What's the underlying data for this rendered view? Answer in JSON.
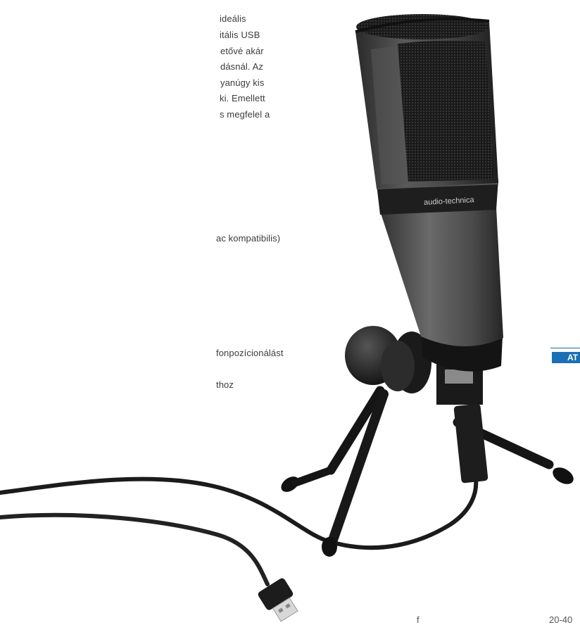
{
  "intro_lines": [
    "ideális",
    "itális USB",
    "etővé akár",
    "dásnál. Az",
    "yanúgy kis",
    "ki. Emellett",
    "s megfelel a"
  ],
  "spec_line": "ac kompatibilis)",
  "feature_lines": [
    "fonpozícionálást",
    "thoz"
  ],
  "brand_label": "audio-technica",
  "badge_label": "AT",
  "footer": {
    "left_glyph": "f",
    "right_text": "20-40"
  },
  "colors": {
    "badge": "#1a6fb5",
    "mic_body": "#3a3a3a",
    "cable": "#1b1b1b"
  }
}
